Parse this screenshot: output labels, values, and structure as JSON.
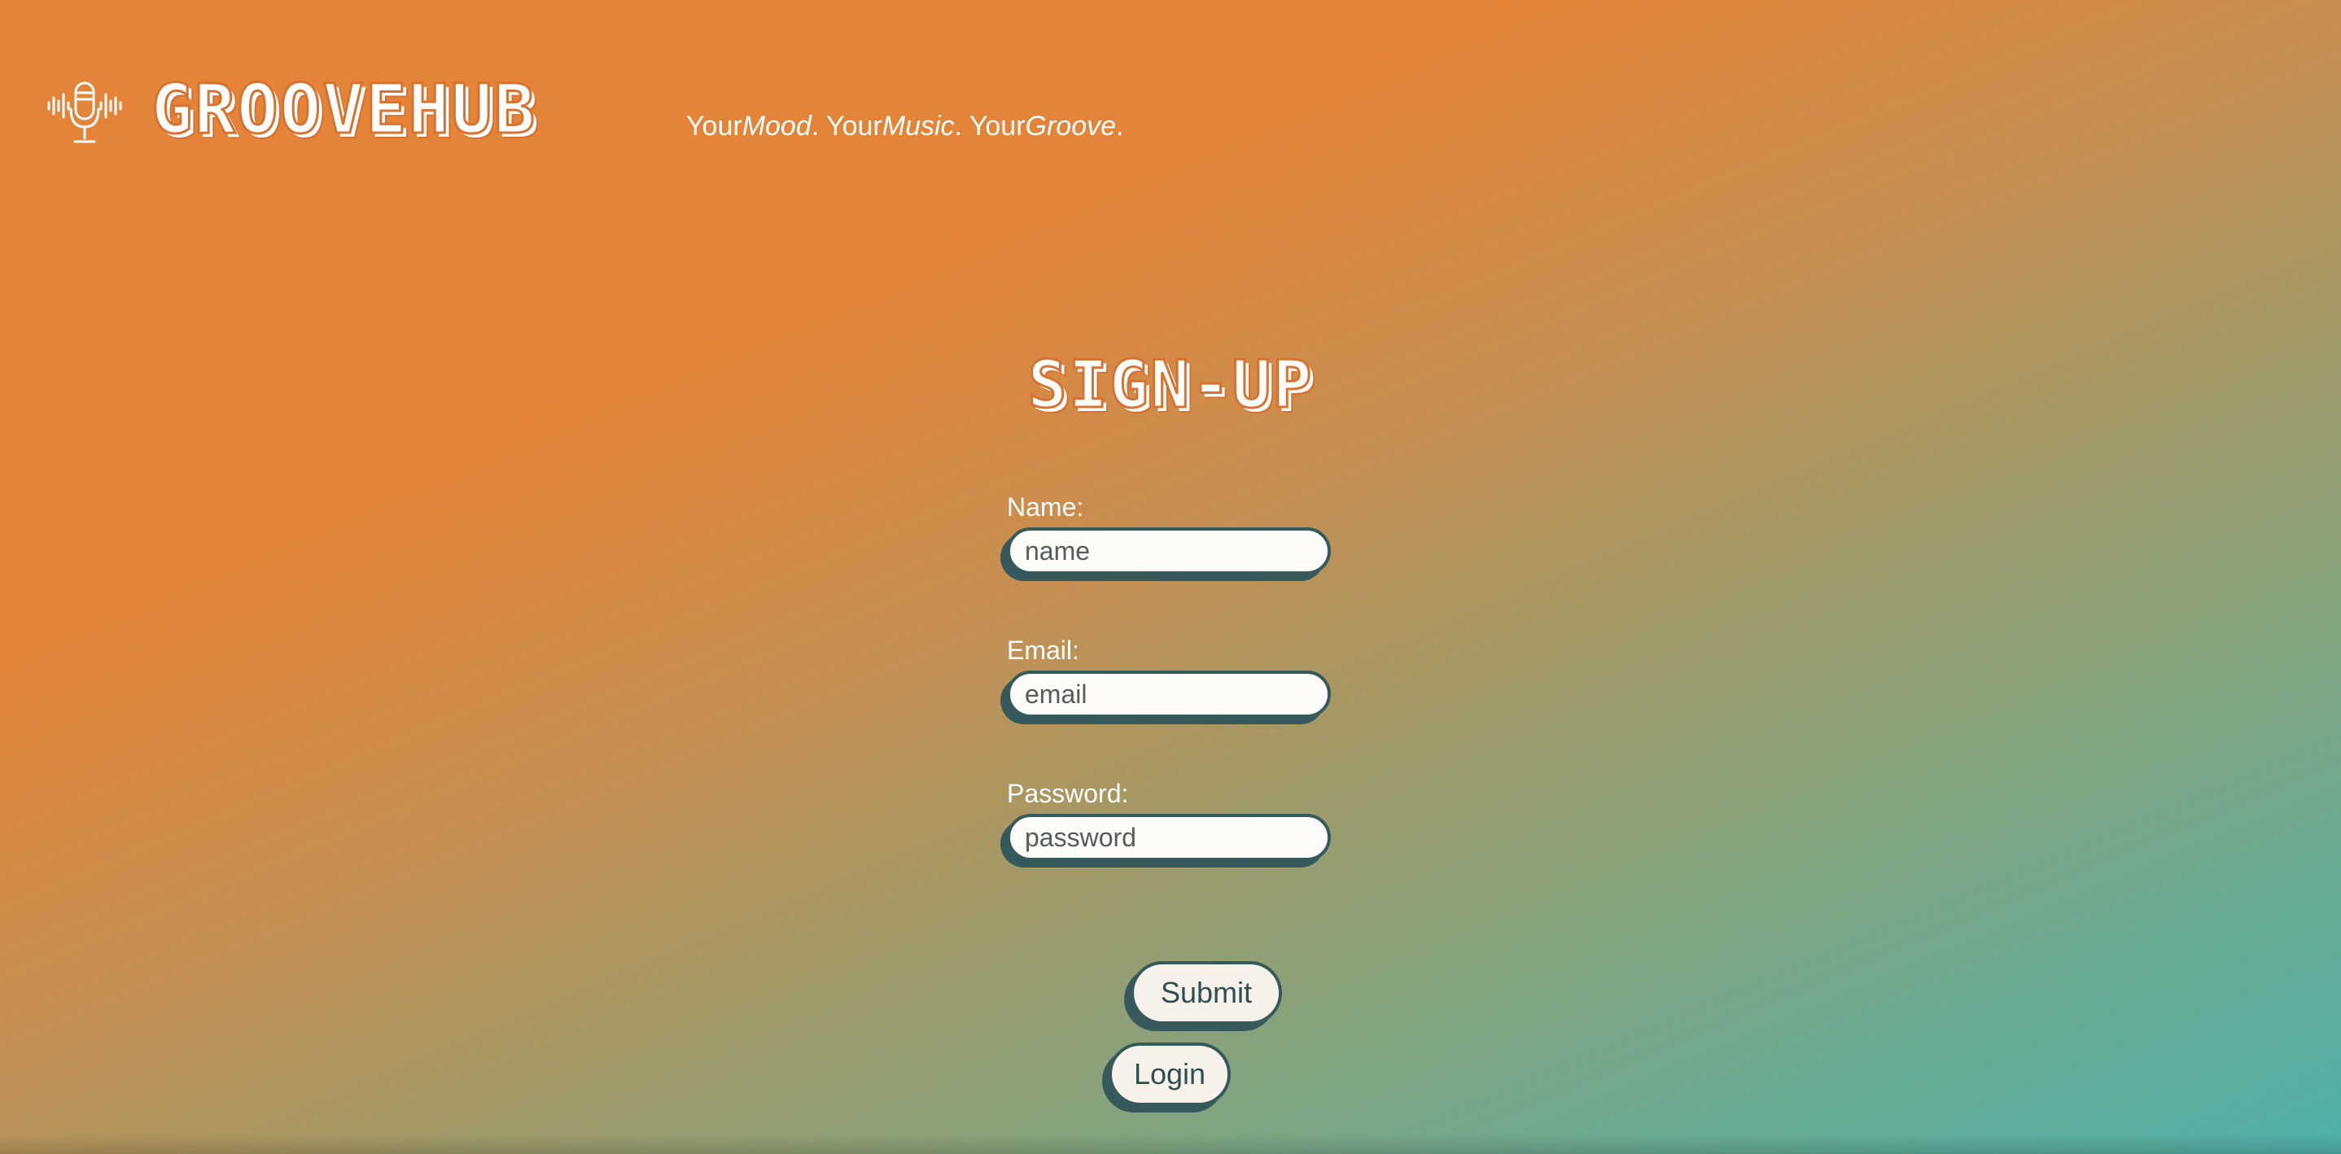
{
  "header": {
    "brand": "GROOVEHUB",
    "logo_icon": "microphone-soundwave-icon",
    "tagline": [
      {
        "text": "Your",
        "italic": false
      },
      {
        "text": "Mood",
        "italic": true
      },
      {
        "text": ". Your",
        "italic": false
      },
      {
        "text": "Music",
        "italic": true
      },
      {
        "text": ". Your",
        "italic": false
      },
      {
        "text": "Groove",
        "italic": true
      },
      {
        "text": ".",
        "italic": false
      }
    ]
  },
  "form": {
    "title": "SIGN-UP",
    "name": {
      "label": "Name:",
      "placeholder": "name",
      "value": ""
    },
    "email": {
      "label": "Email:",
      "placeholder": "email",
      "value": ""
    },
    "password": {
      "label": "Password:",
      "placeholder": "password",
      "value": ""
    },
    "submit_label": "Submit",
    "login_label": "Login"
  },
  "colors": {
    "accent_orange": "#e38439",
    "accent_teal": "#4fb0a7",
    "button_border": "#365a5c",
    "button_fill": "#f6f2ea"
  }
}
